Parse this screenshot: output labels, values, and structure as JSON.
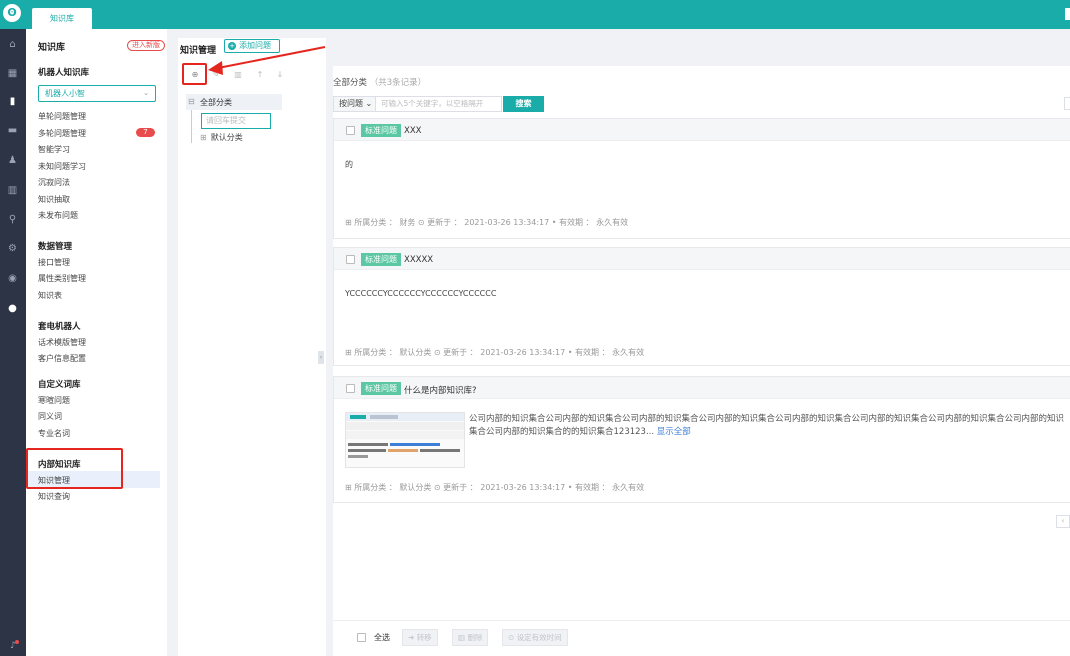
{
  "topbar": {
    "logo": "ʘ",
    "active_tab": "知识库"
  },
  "rail": {
    "icons": [
      "home-icon",
      "grid-icon",
      "book-icon",
      "chat-icon",
      "users-icon",
      "chart-icon",
      "search-icon",
      "gear-icon",
      "globe-icon",
      "robot-icon",
      "bell-icon"
    ]
  },
  "nav": {
    "title": "知识库",
    "new_version": "进入新版",
    "robot_group": "机器人知识库",
    "robot_select": "机器人小智",
    "robot_items": [
      "单轮问题管理",
      "多轮问题管理",
      "智能学习",
      "未知问题学习",
      "沉寂问法",
      "知识抽取",
      "未发布问题"
    ],
    "multi_round_count": "7",
    "data_group": "数据管理",
    "data_items": [
      "接口管理",
      "属性类别管理",
      "知识表"
    ],
    "phone_group": "套电机器人",
    "phone_items": [
      "话术模版管理",
      "客户信息配置"
    ],
    "custom_group": "自定义词库",
    "custom_items": [
      "寒暄问题",
      "同义词",
      "专业名词"
    ],
    "internal_group": "内部知识库",
    "internal_items": [
      "知识管理",
      "知识查询"
    ]
  },
  "catpanel": {
    "page_title": "知识管理",
    "add_button": "添加问题",
    "tree_all": "全部分类",
    "tree_input_placeholder": "请回车提交",
    "tree_default": "默认分类"
  },
  "content": {
    "crumb": "全部分类",
    "crumb_count": "（共3条记录）",
    "search_type": "按问题",
    "search_placeholder": "可输入5个关键字，以空格隔开",
    "search_button": "搜索",
    "cards": [
      {
        "tag": "标准问题",
        "title": "XXX",
        "body": "的",
        "category_label": "所属分类",
        "category": "财务",
        "updated_label": "更新于",
        "updated": "2021-03-26 13:34:17",
        "validity_label": "有效期",
        "validity": "永久有效"
      },
      {
        "tag": "标准问题",
        "title": "XXXXX",
        "body": "YCCCCCCYCCCCCCYCCCCCCYCCCCCC",
        "category_label": "所属分类",
        "category": "默认分类",
        "updated_label": "更新于",
        "updated": "2021-03-26 13:34:17",
        "validity_label": "有效期",
        "validity": "永久有效"
      },
      {
        "tag": "标准问题",
        "title": "什么是内部知识库?",
        "body": "公司内部的知识集合公司内部的知识集合公司内部的知识集合公司内部的知识集合公司内部的知识集合公司内部的知识集合公司内部的知识集合公司内部的知识集合公司内部的知识集合的的知识集合123123...",
        "more": "显示全部",
        "category_label": "所属分类",
        "category": "默认分类",
        "updated_label": "更新于",
        "updated": "2021-03-26 13:34:17",
        "validity_label": "有效期",
        "validity": "永久有效"
      }
    ]
  },
  "bottombar": {
    "select_all": "全选",
    "move": "转移",
    "delete": "删除",
    "set_valid": "设定有效时间"
  },
  "colors": {
    "accent": "#1aaca8",
    "tag": "#5cc7a3",
    "alert": "#e5261f",
    "rail": "#2d3446"
  }
}
